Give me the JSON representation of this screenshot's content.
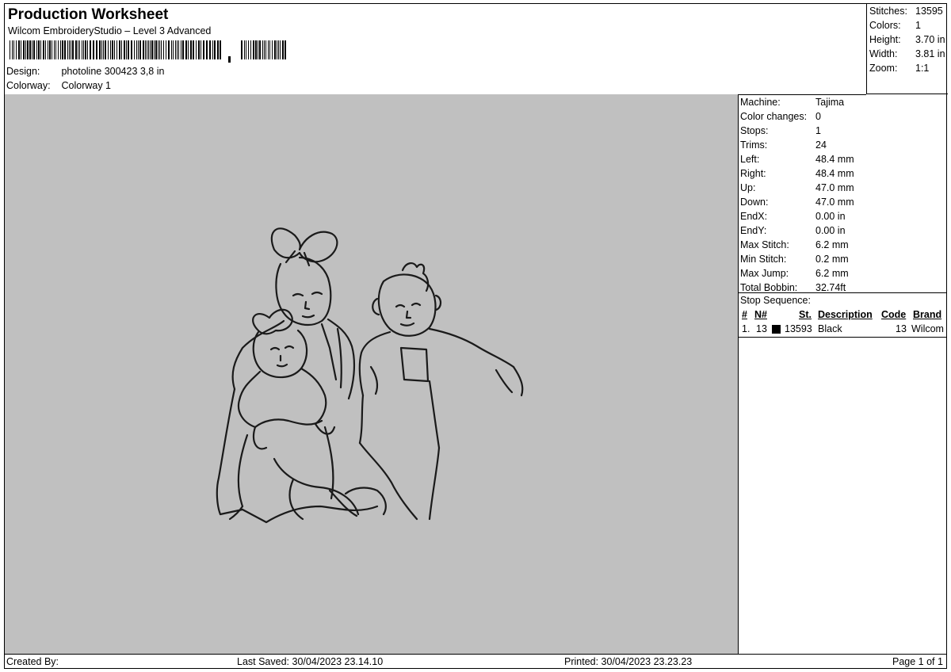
{
  "header": {
    "title": "Production Worksheet",
    "software": "Wilcom EmbroideryStudio – Level 3 Advanced",
    "design_label": "Design:",
    "design_value": "photoline 300423 3,8 in",
    "colorway_label": "Colorway:",
    "colorway_value": "Colorway 1"
  },
  "stats": {
    "stitches_label": "Stitches:",
    "stitches": "13595",
    "colors_label": "Colors:",
    "colors": "1",
    "height_label": "Height:",
    "height": "3.70 in",
    "width_label": "Width:",
    "width": "3.81 in",
    "zoom_label": "Zoom:",
    "zoom": "1:1"
  },
  "machine_info": [
    {
      "label": "Machine:",
      "value": "Tajima"
    },
    {
      "label": "Color changes:",
      "value": "0"
    },
    {
      "label": "Stops:",
      "value": "1"
    },
    {
      "label": "Trims:",
      "value": "24"
    },
    {
      "label": "Left:",
      "value": "48.4 mm"
    },
    {
      "label": "Right:",
      "value": "48.4 mm"
    },
    {
      "label": "Up:",
      "value": "47.0 mm"
    },
    {
      "label": "Down:",
      "value": "47.0 mm"
    },
    {
      "label": "EndX:",
      "value": "0.00 in"
    },
    {
      "label": "EndY:",
      "value": "0.00 in"
    },
    {
      "label": "Max Stitch:",
      "value": "6.2 mm"
    },
    {
      "label": "Min Stitch:",
      "value": "0.2 mm"
    },
    {
      "label": "Max Jump:",
      "value": "6.2 mm"
    },
    {
      "label": "Total Bobbin:",
      "value": "32.74ft"
    }
  ],
  "stop_sequence": {
    "title": "Stop Sequence:",
    "columns": {
      "num": "#",
      "n": "N#",
      "st": "St.",
      "description": "Description",
      "code": "Code",
      "brand": "Brand"
    },
    "rows": [
      {
        "num": "1.",
        "n": "13",
        "color": "#000000",
        "st": "13593",
        "description": "Black",
        "code": "13",
        "brand": "Wilcom"
      }
    ]
  },
  "footer": {
    "created_by": "Created By:",
    "last_saved": "Last Saved: 30/04/2023 23.14.10",
    "printed": "Printed: 30/04/2023 23.23.23",
    "page": "Page 1 of 1"
  }
}
